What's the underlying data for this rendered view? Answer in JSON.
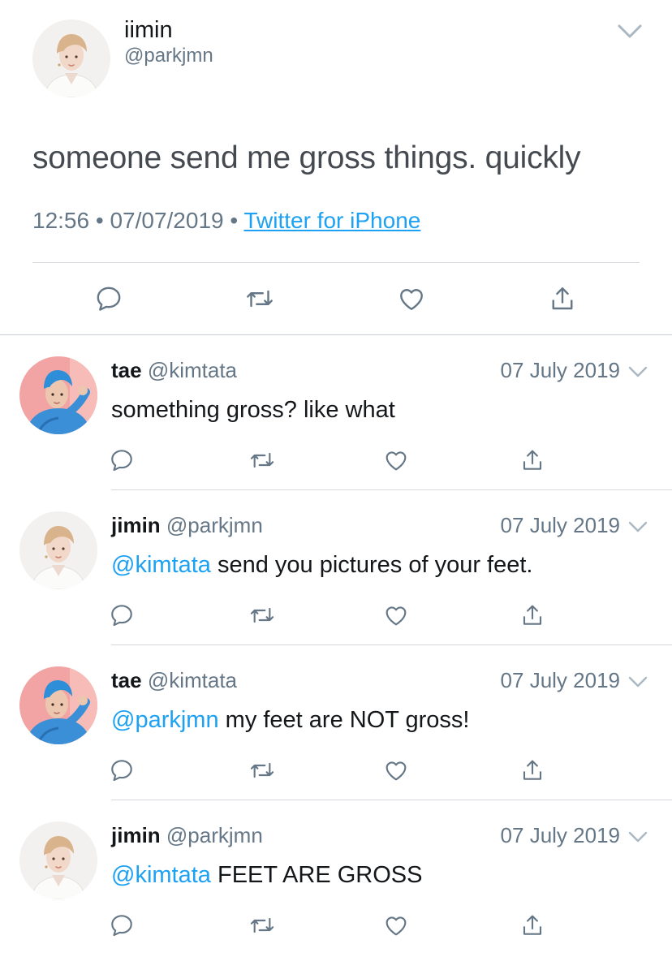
{
  "main_tweet": {
    "display_name": "iimin",
    "handle": "@parkjmn",
    "text": "someone send me gross things. quickly",
    "time": "12:56",
    "date": "07/07/2019",
    "separator": "•",
    "source": "Twitter for iPhone",
    "avatar_icon": "profile-photo-light-hair-white-shirt"
  },
  "replies": [
    {
      "display_name": "tae",
      "handle": "@kimtata",
      "date": "07 July 2019",
      "mention": "",
      "text": "something gross? like what",
      "avatar_icon": "profile-photo-blue-hair-blue-shirt"
    },
    {
      "display_name": "jimin",
      "handle": "@parkjmn",
      "date": "07 July 2019",
      "mention": "@kimtata",
      "text": "send you pictures of your feet.",
      "avatar_icon": "profile-photo-light-hair-white-shirt"
    },
    {
      "display_name": "tae",
      "handle": "@kimtata",
      "date": "07 July 2019",
      "mention": "@parkjmn",
      "text": "my feet are NOT gross!",
      "avatar_icon": "profile-photo-blue-hair-blue-shirt"
    },
    {
      "display_name": "jimin",
      "handle": "@parkjmn",
      "date": "07 July 2019",
      "mention": "@kimtata",
      "text": "FEET ARE GROSS",
      "avatar_icon": "profile-photo-light-hair-white-shirt"
    }
  ],
  "actions": [
    "reply-icon",
    "retweet-icon",
    "like-icon",
    "share-icon"
  ],
  "colors": {
    "link": "#1da1f2",
    "secondary_text": "#657786",
    "icon": "#657786",
    "primary_text": "#14171a"
  }
}
